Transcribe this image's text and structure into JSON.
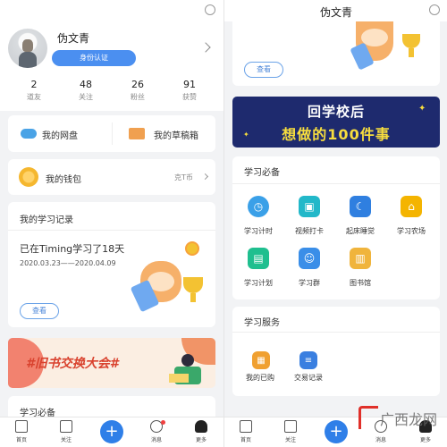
{
  "profile": {
    "name": "伪文青",
    "verify_label": "身份认证",
    "stats": [
      {
        "value": "2",
        "label": "道友"
      },
      {
        "value": "48",
        "label": "关注"
      },
      {
        "value": "26",
        "label": "粉丝"
      },
      {
        "value": "91",
        "label": "获赞"
      }
    ]
  },
  "quick": {
    "disk": "我的网盘",
    "drafts": "我的草稿箱"
  },
  "wallet": {
    "label": "我的钱包",
    "currency": "克T币"
  },
  "record": {
    "title": "我的学习记录",
    "summary": "已在Timing学习了18天",
    "date_range": "2020.03.23——2020.04.09",
    "view_label": "查看"
  },
  "banners": {
    "book_swap": "#旧书交换大会#",
    "after_school_line1": "回学校后",
    "after_school_line2": "想做的100件事"
  },
  "right_header": {
    "name": "伪文青",
    "view_label": "查看"
  },
  "study_essentials": {
    "title": "学习必备",
    "items": [
      {
        "label": "学习计时",
        "icon": "clock-icon",
        "color": "#3aa0e8"
      },
      {
        "label": "视频打卡",
        "icon": "camera-icon",
        "color": "#22b8c9"
      },
      {
        "label": "起床睡觉",
        "icon": "moon-icon",
        "color": "#2f7fe0"
      },
      {
        "label": "学习农场",
        "icon": "farm-icon",
        "color": "#f4b400"
      },
      {
        "label": "学习计划",
        "icon": "plan-icon",
        "color": "#1fbf8f"
      },
      {
        "label": "学习群",
        "icon": "group-icon",
        "color": "#3a8ee8"
      },
      {
        "label": "图书馆",
        "icon": "library-icon",
        "color": "#f0b43c"
      }
    ]
  },
  "study_services": {
    "title": "学习服务",
    "items": [
      {
        "label": "我的已购",
        "icon": "purchased-icon",
        "color": "#f0a030"
      },
      {
        "label": "交易记录",
        "icon": "transactions-icon",
        "color": "#3a7fe0"
      }
    ]
  },
  "tabbar": {
    "home": "首页",
    "follow": "关注",
    "add": "+",
    "messages": "消息",
    "more": "更多"
  },
  "watermark": "广西龙网",
  "colors": {
    "accent": "#2f7fe8",
    "banner_dark": "#1e2a6e",
    "banner_yellow": "#f7dd3e"
  }
}
